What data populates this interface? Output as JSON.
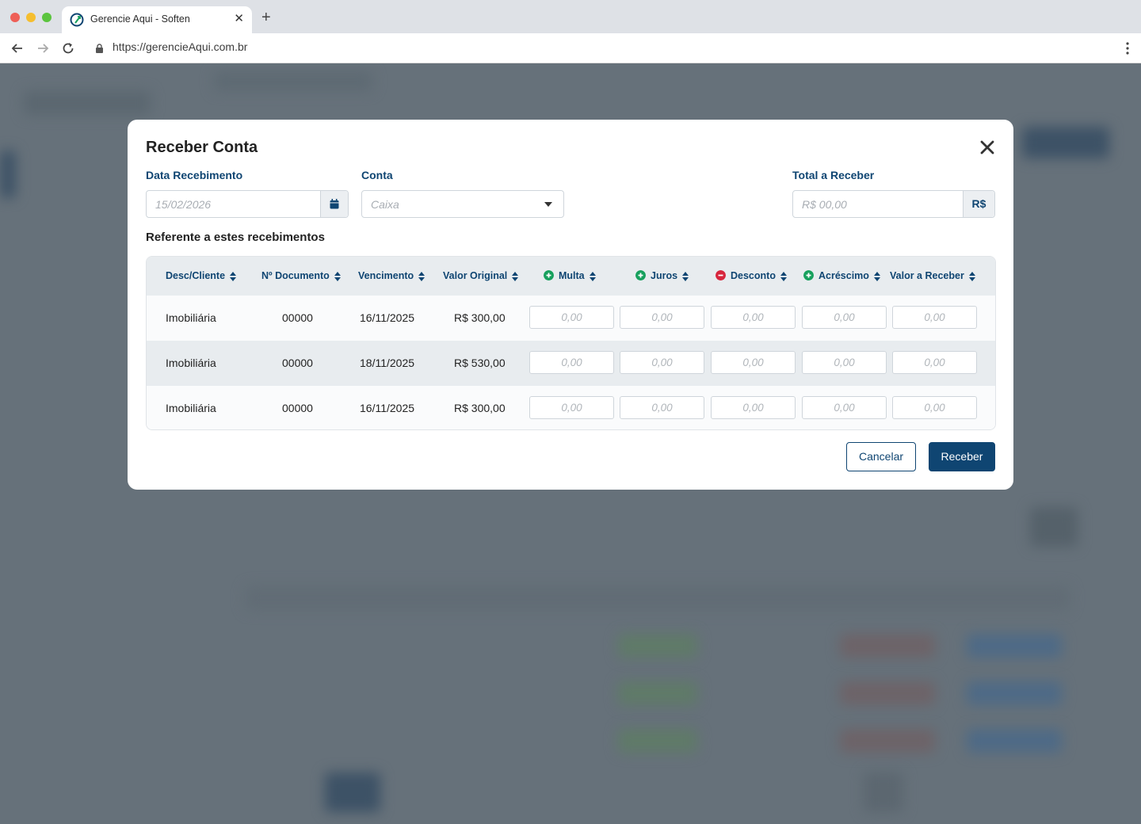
{
  "browser": {
    "tab_title": "Gerencie Aqui - Soften",
    "url": "https://gerencieAqui.com.br"
  },
  "modal": {
    "title": "Receber Conta",
    "fields": {
      "data_recebimento": {
        "label": "Data Recebimento",
        "placeholder": "15/02/2026"
      },
      "conta": {
        "label": "Conta",
        "placeholder": "Caixa"
      },
      "total_receber": {
        "label": "Total a Receber",
        "placeholder": "R$ 00,00",
        "addon": "R$"
      }
    },
    "section_title": "Referente a estes recebimentos",
    "table": {
      "headers": [
        "Desc/Cliente",
        "Nº Documento",
        "Vencimento",
        "Valor Original",
        "Multa",
        "Juros",
        "Desconto",
        "Acréscimo",
        "Valor a Receber"
      ],
      "rows": [
        {
          "cliente": "Imobiliária",
          "documento": "00000",
          "vencimento": "16/11/2025",
          "valor": "R$ 300,00",
          "inputs": [
            "0,00",
            "0,00",
            "0,00",
            "0,00",
            "0,00"
          ]
        },
        {
          "cliente": "Imobiliária",
          "documento": "00000",
          "vencimento": "18/11/2025",
          "valor": "R$ 530,00",
          "inputs": [
            "0,00",
            "0,00",
            "0,00",
            "0,00",
            "0,00"
          ]
        },
        {
          "cliente": "Imobiliária",
          "documento": "00000",
          "vencimento": "16/11/2025",
          "valor": "R$ 300,00",
          "inputs": [
            "0,00",
            "0,00",
            "0,00",
            "0,00",
            "0,00"
          ]
        }
      ]
    },
    "buttons": {
      "cancel": "Cancelar",
      "submit": "Receber"
    }
  },
  "colors": {
    "primary": "#0f4572",
    "plus_sign": "#17a05d",
    "minus_sign": "#d7263d",
    "overlay": "#66717a"
  },
  "icons": {
    "close": "close-icon",
    "calendar": "calendar-icon",
    "dropdown": "caret-down-icon",
    "sort": "sort-icon",
    "plus": "plus-circle-icon",
    "minus": "minus-circle-icon"
  }
}
